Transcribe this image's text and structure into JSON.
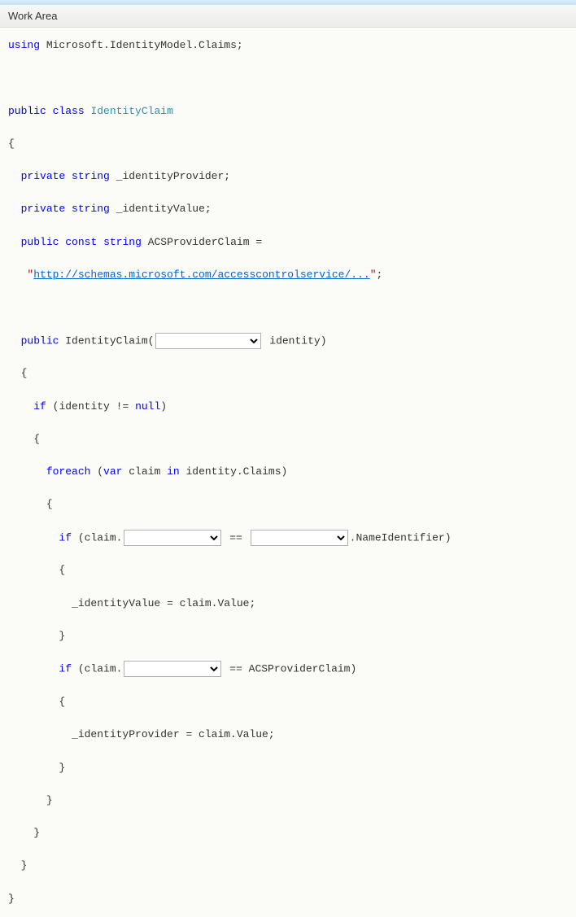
{
  "header": {
    "title": "Work Area"
  },
  "code": {
    "kw_using": "using",
    "ns": "Microsoft.IdentityModel.Claims",
    "kw_public": "public",
    "kw_class": "class",
    "className": "IdentityClaim",
    "kw_private": "private",
    "kw_string": "string",
    "field1": "_identityProvider",
    "field2": "_identityValue",
    "kw_const": "const",
    "constName": "ACSProviderClaim",
    "url": "http://schemas.microsoft.com/accesscontrolservice/...",
    "paramText": "identity)",
    "kw_if": "if",
    "cond1_a": "(identity != ",
    "kw_null": "null",
    "cond1_b": ")",
    "kw_foreach": "foreach",
    "kw_var": "var",
    "foreach_a": "(",
    "foreach_b": " claim ",
    "kw_in": "in",
    "foreach_c": " identity.Claims)",
    "claimDot": "(claim.",
    "eqeq": " == ",
    "nameId": ".NameIdentifier)",
    "assign1": "_identityValue = claim.Value;",
    "acsComp": " == ACSProviderClaim)",
    "assign2": "_identityProvider = claim.Value;",
    "brace_open": "{",
    "brace_close": "}",
    "semi": ";",
    "eq": " = ",
    "quote": "\"",
    "paren_open": "("
  }
}
